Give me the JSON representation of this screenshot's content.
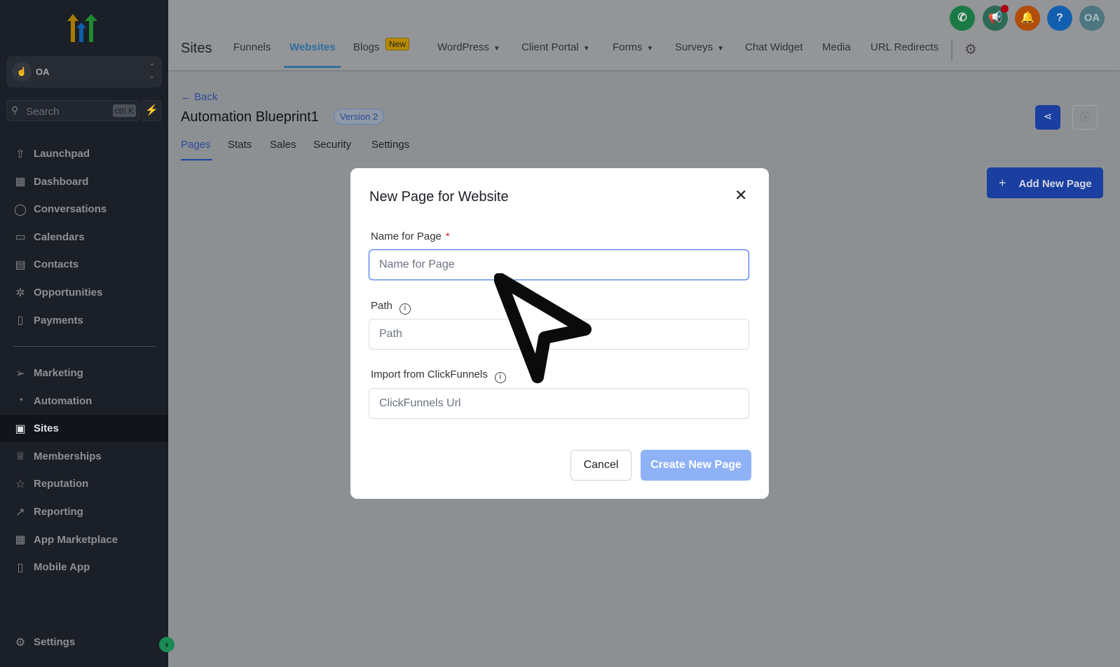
{
  "sidebar": {
    "account": "OA",
    "search_placeholder": "Search",
    "shortcut": "ctrl K",
    "items": [
      {
        "label": "Launchpad",
        "icon": "⇧"
      },
      {
        "label": "Dashboard",
        "icon": "▦"
      },
      {
        "label": "Conversations",
        "icon": "◯"
      },
      {
        "label": "Calendars",
        "icon": "▭"
      },
      {
        "label": "Contacts",
        "icon": "▤"
      },
      {
        "label": "Opportunities",
        "icon": "✲"
      },
      {
        "label": "Payments",
        "icon": "▯"
      }
    ],
    "items2": [
      {
        "label": "Marketing",
        "icon": "➢"
      },
      {
        "label": "Automation",
        "icon": "◔"
      },
      {
        "label": "Sites",
        "icon": "▣"
      },
      {
        "label": "Memberships",
        "icon": "♕"
      },
      {
        "label": "Reputation",
        "icon": "☆"
      },
      {
        "label": "Reporting",
        "icon": "↗"
      },
      {
        "label": "App Marketplace",
        "icon": "▦"
      },
      {
        "label": "Mobile App",
        "icon": "▯"
      }
    ],
    "settings": "Settings"
  },
  "header": {
    "title": "Sites",
    "tabs": [
      "Funnels",
      "Websites",
      "Blogs",
      "WordPress",
      "Client Portal",
      "Forms",
      "Surveys",
      "Chat Widget",
      "Media",
      "URL Redirects"
    ],
    "new_badge": "New",
    "avatar": "OA",
    "colors": {
      "phone": "#1a7a45",
      "megaphone": "#2d6a55",
      "bell": "#b04e0a",
      "help": "#125fb0",
      "avatar": "#4e7680"
    }
  },
  "page": {
    "back": "Back",
    "title": "Automation Blueprint1",
    "version": "Version 2",
    "tabs": [
      "Pages",
      "Stats",
      "Sales",
      "Security",
      "Settings"
    ],
    "add_button": "Add New Page"
  },
  "modal": {
    "title": "New Page for Website",
    "name_label": "Name for Page",
    "required": "*",
    "name_placeholder": "Name for Page",
    "path_label": "Path",
    "path_placeholder": "Path",
    "import_label": "Import from ClickFunnels",
    "import_placeholder": "ClickFunnels Url",
    "cancel": "Cancel",
    "create": "Create New Page"
  }
}
